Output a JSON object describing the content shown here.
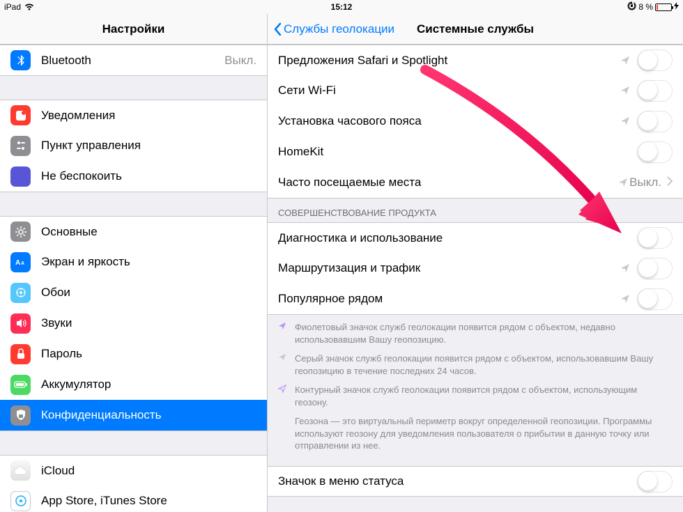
{
  "status": {
    "device": "iPad",
    "time": "15:12",
    "battery_pct": "8 %"
  },
  "sidebar": {
    "title": "Настройки",
    "items": {
      "bluetooth": {
        "label": "Bluetooth",
        "value": "Выкл."
      },
      "notifications": {
        "label": "Уведомления"
      },
      "control_center": {
        "label": "Пункт управления"
      },
      "dnd": {
        "label": "Не беспокоить"
      },
      "general": {
        "label": "Основные"
      },
      "display": {
        "label": "Экран и яркость"
      },
      "wallpaper": {
        "label": "Обои"
      },
      "sounds": {
        "label": "Звуки"
      },
      "passcode": {
        "label": "Пароль"
      },
      "battery": {
        "label": "Аккумулятор"
      },
      "privacy": {
        "label": "Конфиденциальность"
      },
      "icloud": {
        "label": "iCloud"
      },
      "appstore": {
        "label": "App Store, iTunes Store"
      }
    }
  },
  "detail": {
    "back_label": "Службы геолокации",
    "title": "Системные службы",
    "group1": {
      "safari": "Предложения Safari и Spotlight",
      "wifi": "Сети Wi-Fi",
      "timezone": "Установка часового пояса",
      "homekit": "HomeKit",
      "frequent": "Часто посещаемые места",
      "frequent_value": "Выкл."
    },
    "section_header": "Совершенствование продукта",
    "group2": {
      "diagnostics": "Диагностика и использование",
      "routing": "Маршрутизация и трафик",
      "popular": "Популярное рядом"
    },
    "footer": {
      "n1": "Фиолетовый значок служб геолокации появится рядом с объектом, недавно использовавшим Вашу геопозицию.",
      "n2": "Серый значок служб геолокации появится рядом с объектом, использовавшим Вашу геопозицию в течение последних 24 часов.",
      "n3": "Контурный значок служб геолокации появится рядом с объектом, использующим геозону.",
      "n4": "Геозона — это виртуальный периметр вокруг определенной геопозиции. Программы используют геозону для уведомления пользователя о прибытии в данную точку или отправлении из нее."
    },
    "group3": {
      "status_icon": "Значок в меню статуса"
    }
  }
}
